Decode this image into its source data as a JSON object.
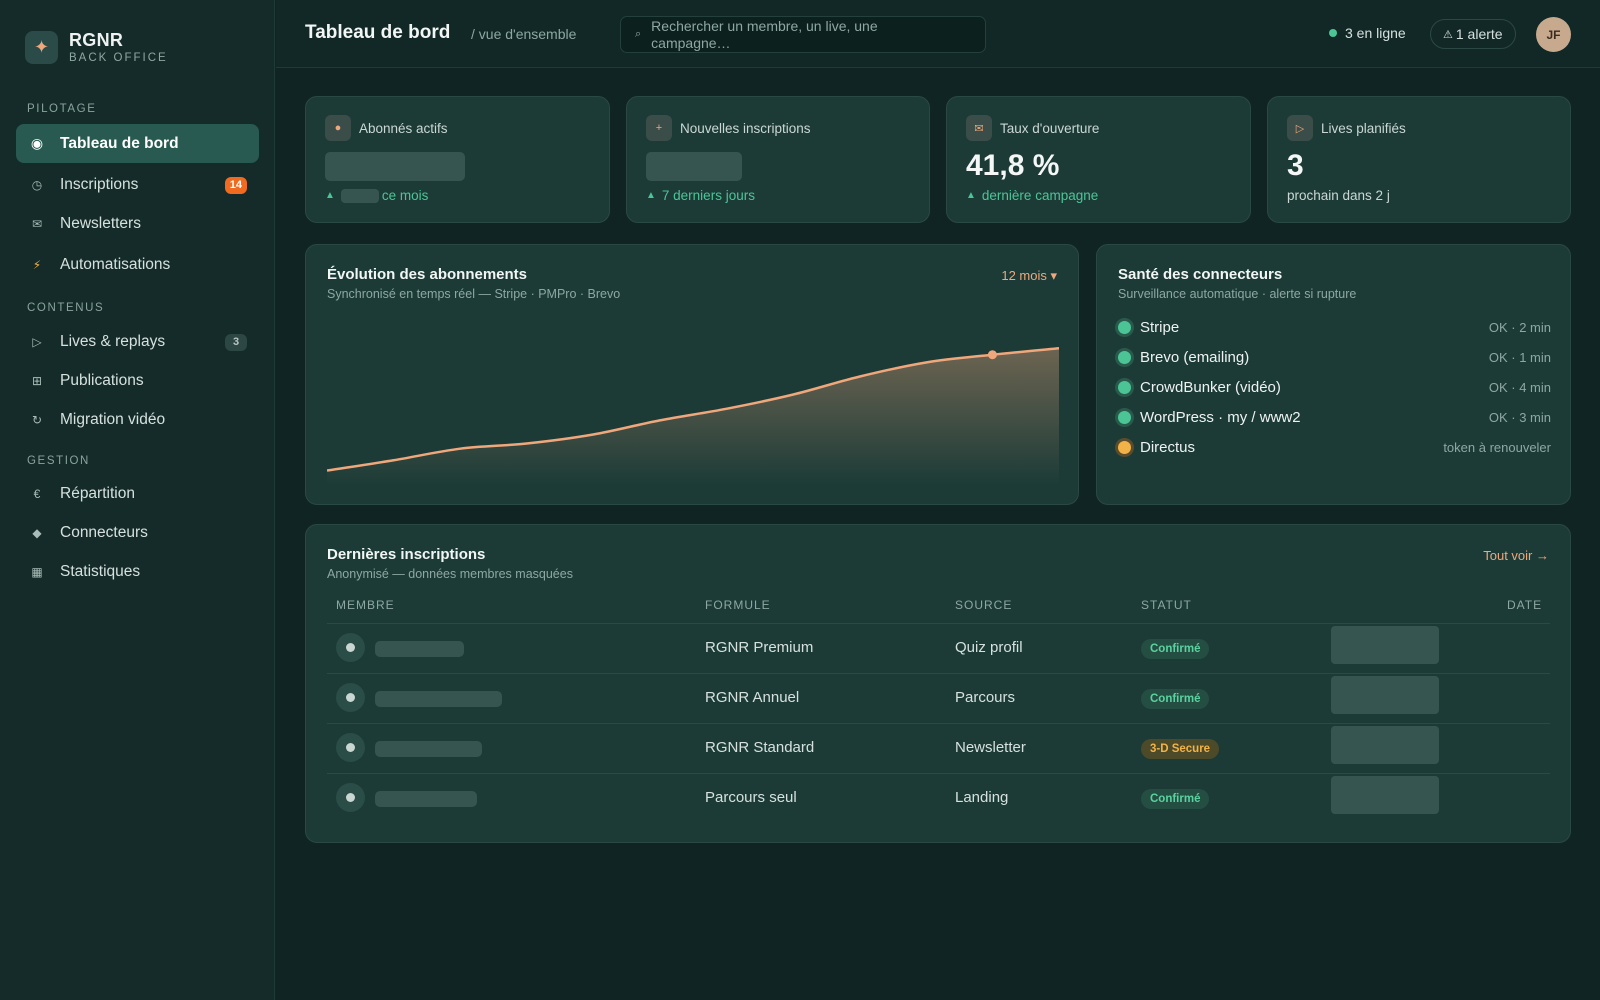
{
  "brand": {
    "name": "RGNR",
    "subtitle": "BACK OFFICE",
    "logo_icon": "✦"
  },
  "sidebar": {
    "sections": [
      "PILOTAGE",
      "CONTENUS",
      "GESTION"
    ],
    "items": [
      {
        "label": "Tableau de bord",
        "icon": "◉",
        "active": true
      },
      {
        "label": "Inscriptions",
        "icon": "◷",
        "badge": "14"
      },
      {
        "label": "Newsletters",
        "icon": "✉"
      },
      {
        "label": "Automatisations",
        "icon": "⚡"
      },
      {
        "label": "Lives & replays",
        "icon": "▷",
        "badge": "3"
      },
      {
        "label": "Publications",
        "icon": "⊞"
      },
      {
        "label": "Migration vidéo",
        "icon": "↻"
      },
      {
        "label": "Répartition",
        "icon": "€"
      },
      {
        "label": "Connecteurs",
        "icon": "◆"
      },
      {
        "label": "Statistiques",
        "icon": "▦"
      }
    ]
  },
  "header": {
    "title": "Tableau de bord",
    "crumb": "/ vue d'ensemble",
    "search_placeholder": "Rechercher un membre, un live, une campagne…",
    "online": "3 en ligne",
    "alert_icon": "⚠",
    "alert": "1 alerte",
    "avatar": "JF"
  },
  "kpis": [
    {
      "label": "Abonnés actifs",
      "icon": "●",
      "value": "",
      "foot": "ce mois"
    },
    {
      "label": "Nouvelles inscriptions",
      "icon": "+",
      "value": "",
      "foot": "7 derniers jours"
    },
    {
      "label": "Taux d'ouverture",
      "icon": "✉",
      "value": "41,8 %",
      "foot": "dernière campagne"
    },
    {
      "label": "Lives planifiés",
      "icon": "▷",
      "value": "3",
      "foot": "prochain dans 2 j"
    }
  ],
  "chart_panel": {
    "title": "Évolution des abonnements",
    "subtitle": "Synchronisé en temps réel — Stripe · PMPro · Brevo",
    "period": "12 mois ▾"
  },
  "chart_data": {
    "type": "area",
    "title": "Évolution des abonnements",
    "xlabel": "",
    "ylabel": "",
    "x": [
      1,
      2,
      3,
      4,
      5,
      6,
      7,
      8,
      9,
      10,
      11,
      12
    ],
    "values": [
      0.05,
      0.13,
      0.22,
      0.26,
      0.33,
      0.44,
      0.53,
      0.64,
      0.78,
      0.89,
      0.95,
      1.0
    ],
    "highlight_index": 10,
    "ylim": [
      0,
      1.15
    ],
    "grid": false,
    "colors": {
      "line": "#f0a77c",
      "marker": "#f0a77c"
    }
  },
  "connectors": {
    "title": "Santé des connecteurs",
    "subtitle": "Surveillance automatique · alerte si rupture",
    "items": [
      {
        "name": "Stripe",
        "status": "OK · 2 min",
        "state": "ok"
      },
      {
        "name": "Brevo (emailing)",
        "status": "OK · 1 min",
        "state": "ok"
      },
      {
        "name": "CrowdBunker (vidéo)",
        "status": "OK · 4 min",
        "state": "ok"
      },
      {
        "name": "WordPress · my / www2",
        "status": "OK · 3 min",
        "state": "ok"
      },
      {
        "name": "Directus",
        "status": "token à renouveler",
        "state": "warn"
      }
    ]
  },
  "signups": {
    "title": "Dernières inscriptions",
    "subtitle": "Anonymisé — données membres masquées",
    "link": "Tout voir →",
    "columns": [
      "MEMBRE",
      "FORMULE",
      "SOURCE",
      "STATUT",
      "DATE"
    ],
    "rows": [
      {
        "formula": "RGNR Premium",
        "source": "Quiz profil",
        "status": "Confirmé",
        "state": "ok"
      },
      {
        "formula": "RGNR Annuel",
        "source": "Parcours",
        "status": "Confirmé",
        "state": "ok"
      },
      {
        "formula": "RGNR Standard",
        "source": "Newsletter",
        "status": "3-D Secure",
        "state": "warn"
      },
      {
        "formula": "Parcours seul",
        "source": "Landing",
        "status": "Confirmé",
        "state": "ok"
      }
    ]
  }
}
